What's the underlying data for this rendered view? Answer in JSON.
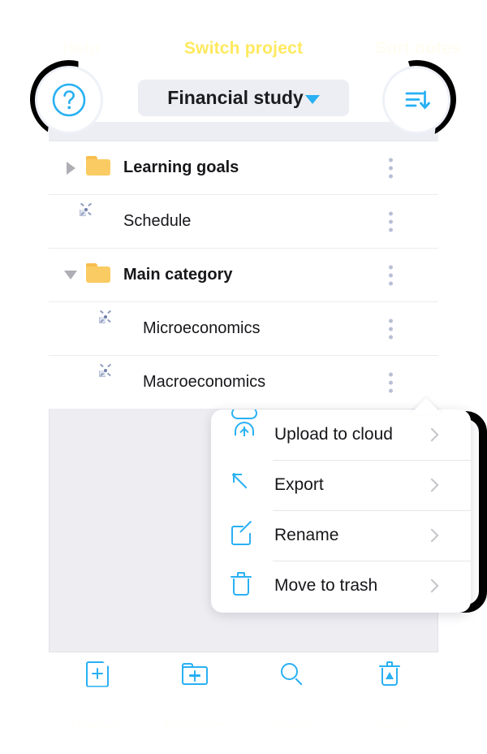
{
  "annotations": {
    "help_caption": "Help",
    "switch_caption": "Switch project",
    "sort_caption": "Sort notes"
  },
  "header": {
    "help_icon": "question-mark-circle-icon",
    "project_name": "Financial study",
    "dropdown_icon": "caret-down-icon",
    "sort_icon": "sort-descending-icon"
  },
  "file_list": [
    {
      "label": "Learning goals",
      "type": "folder",
      "state": "collapsed",
      "indent": 0,
      "menu_icon": "more-vertical-icon"
    },
    {
      "label": "Schedule",
      "type": "file",
      "state": "none",
      "indent": 0,
      "menu_icon": "more-vertical-icon"
    },
    {
      "label": "Main category",
      "type": "folder",
      "state": "expanded",
      "indent": 0,
      "menu_icon": "more-vertical-icon"
    },
    {
      "label": "Microeconomics",
      "type": "file",
      "state": "none",
      "indent": 1,
      "menu_icon": "more-vertical-icon"
    },
    {
      "label": "Macroeconomics",
      "type": "file",
      "state": "none",
      "indent": 1,
      "menu_icon": "more-vertical-icon"
    }
  ],
  "context_menu": [
    {
      "label": "Upload to cloud",
      "icon": "cloud-upload-icon",
      "chevron": "chevron-right-icon"
    },
    {
      "label": "Export",
      "icon": "export-icon",
      "chevron": "chevron-right-icon"
    },
    {
      "label": "Rename",
      "icon": "edit-pencil-icon",
      "chevron": "chevron-right-icon"
    },
    {
      "label": "Move to trash",
      "icon": "trash-icon",
      "chevron": "chevron-right-icon"
    }
  ],
  "toolbar": [
    {
      "label": "New note",
      "icon": "new-file-icon"
    },
    {
      "label": "New folder",
      "icon": "new-folder-icon"
    },
    {
      "label": "Search",
      "icon": "search-icon"
    },
    {
      "label": "Trash",
      "icon": "recycle-bin-icon"
    }
  ],
  "colors": {
    "accent": "#29b0f3",
    "annotation_yellow": "#ffe95e",
    "annotation_black": "#000000",
    "folder_yellow": "#fbcb63",
    "panel_gray": "#eeeef2",
    "pill_gray": "#eceef3",
    "dots_gray": "#b9bfd4"
  }
}
